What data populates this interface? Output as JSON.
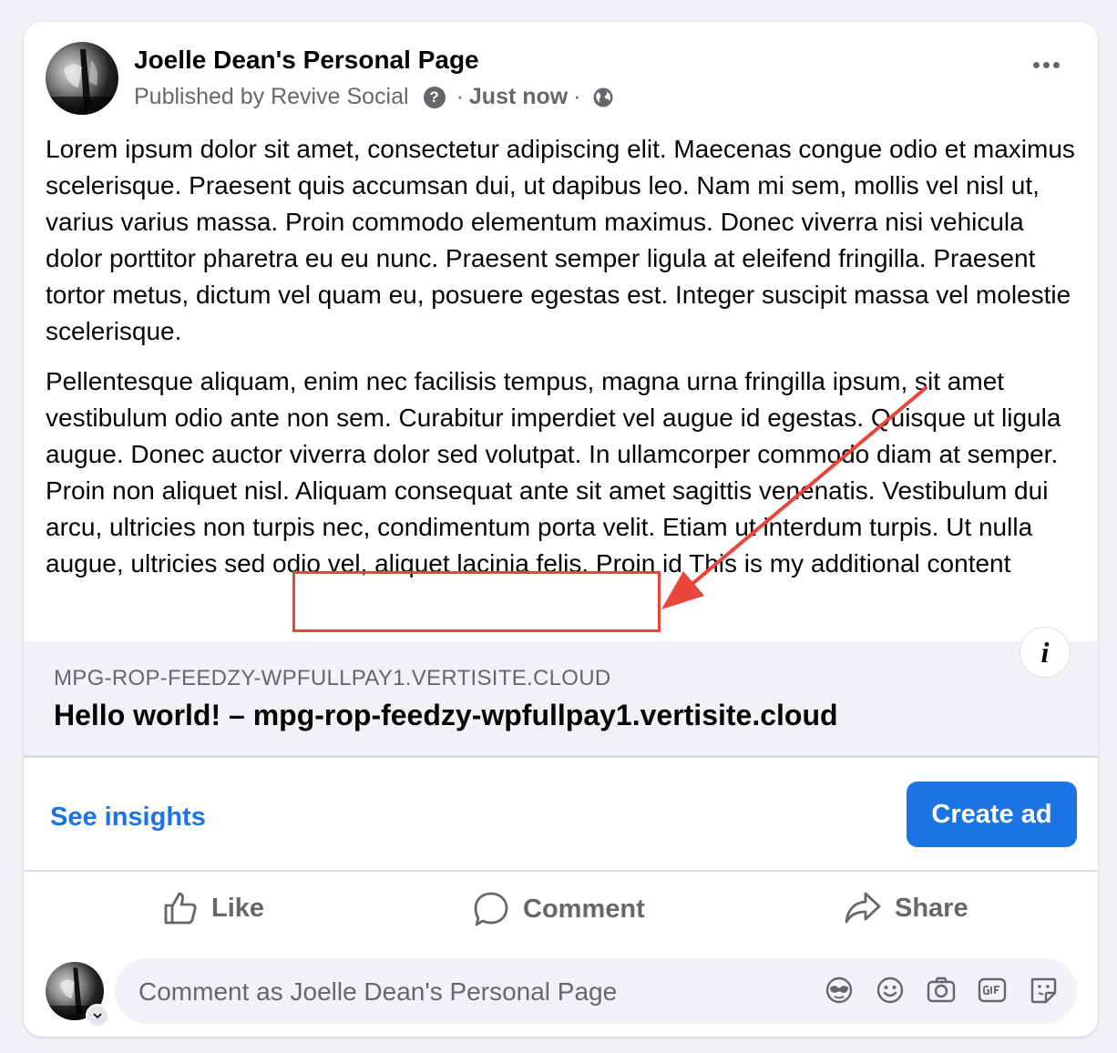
{
  "post": {
    "page_name": "Joelle Dean's Personal Page",
    "published_by": "Published by Revive Social",
    "separator": "·",
    "time": "Just now",
    "help_glyph": "?",
    "paragraph1": "Lorem ipsum dolor sit amet, consectetur adipiscing elit. Maecenas congue odio et maximus scelerisque. Praesent quis accumsan dui, ut dapibus leo. Nam mi sem, mollis vel nisl ut, varius varius massa. Proin commodo elementum maximus. Donec viverra nisi vehicula dolor porttitor pharetra eu eu nunc. Praesent semper ligula at eleifend fringilla. Praesent tortor metus, dictum vel quam eu, posuere egestas est. Integer suscipit massa vel molestie scelerisque.",
    "paragraph2": "Pellentesque aliquam, enim nec facilisis tempus, magna urna fringilla ipsum, sit amet vestibulum odio ante non sem. Curabitur imperdiet vel augue id egestas. Quisque ut ligula augue. Donec auctor viverra dolor sed volutpat. In ullamcorper commodo diam at semper. Proin non aliquet nisl. Aliquam consequat ante sit amet sagittis venenatis. Vestibulum dui arcu, ultricies non turpis nec, condimentum porta velit. Etiam ut interdum turpis. Ut nulla augue, ultricies sed odio vel, aliquet lacinia felis. Proin id",
    "additional_content": "This is my additional content"
  },
  "link_preview": {
    "domain": "MPG-ROP-FEEDZY-WPFULLPAY1.VERTISITE.CLOUD",
    "title": "Hello world! – mpg-rop-feedzy-wpfullpay1.vertisite.cloud",
    "info_glyph": "i"
  },
  "insights": {
    "see_insights": "See insights",
    "create_ad": "Create ad"
  },
  "actions": {
    "like": "Like",
    "comment": "Comment",
    "share": "Share"
  },
  "comment_box": {
    "placeholder": "Comment as Joelle Dean's Personal Page",
    "icons": [
      "avatar-sticker-icon",
      "emoji-icon",
      "camera-icon",
      "gif-icon",
      "sticker-icon"
    ]
  },
  "colors": {
    "accent": "#1b74e4",
    "annotation": "#e8453c",
    "secondary_text": "#65676b"
  }
}
